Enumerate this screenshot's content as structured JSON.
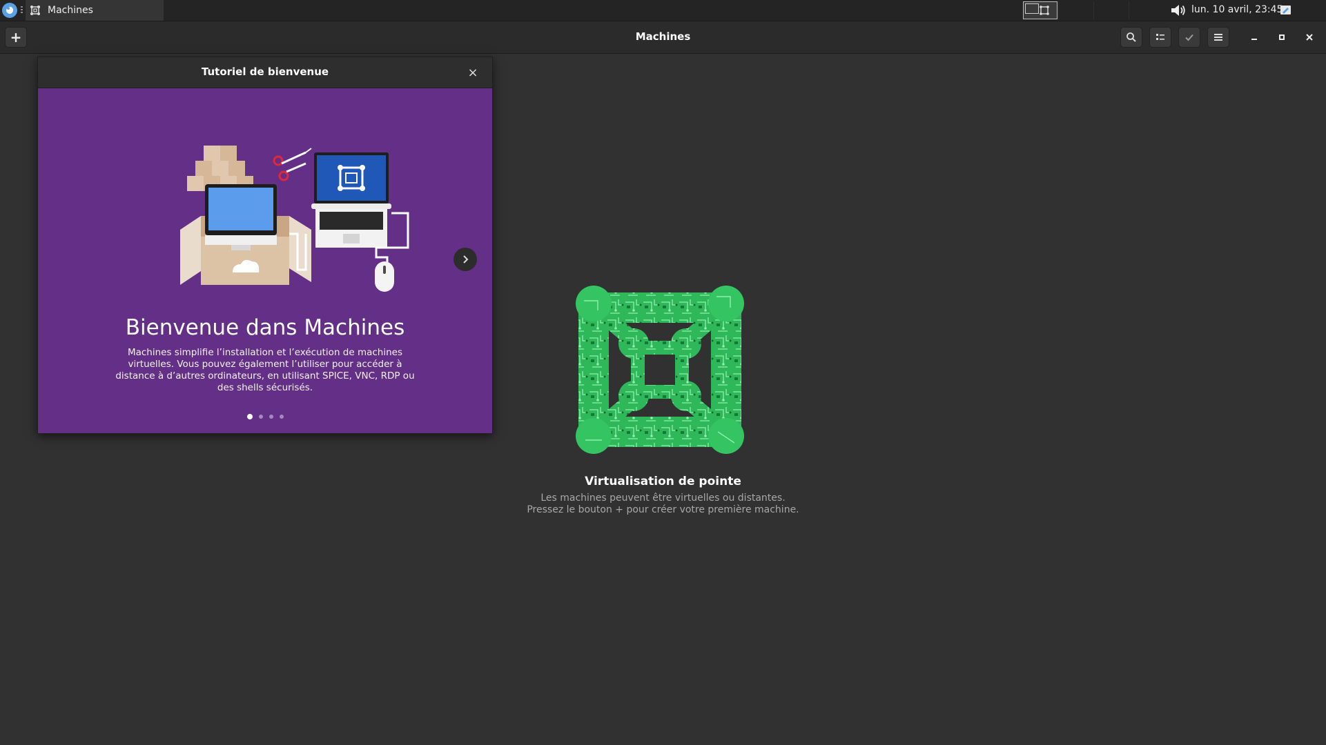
{
  "panel": {
    "task_title": "Machines",
    "clock": "lun. 10 avril, 23:45"
  },
  "headerbar": {
    "new_button": "+",
    "title": "Machines"
  },
  "tutorial": {
    "title": "Tutoriel de bienvenue",
    "close_glyph": "×",
    "heading": "Bienvenue dans Machines",
    "body": "Machines simplifie l’installation et l’exécution de machines virtuelles. Vous pouvez également l’utiliser pour accéder à distance à d’autres ordinateurs, en utilisant SPICE, VNC, RDP ou des shells sécurisés.",
    "page_count": 4,
    "current_page": 1
  },
  "empty_state": {
    "title": "Virtualisation de pointe",
    "line1": "Les machines peuvent être virtuelles ou distantes.",
    "line2": "Pressez le bouton + pour créer votre première machine."
  },
  "colors": {
    "accent_purple": "#642f86",
    "logo_green": "#3ad16b",
    "background": "#313131"
  }
}
